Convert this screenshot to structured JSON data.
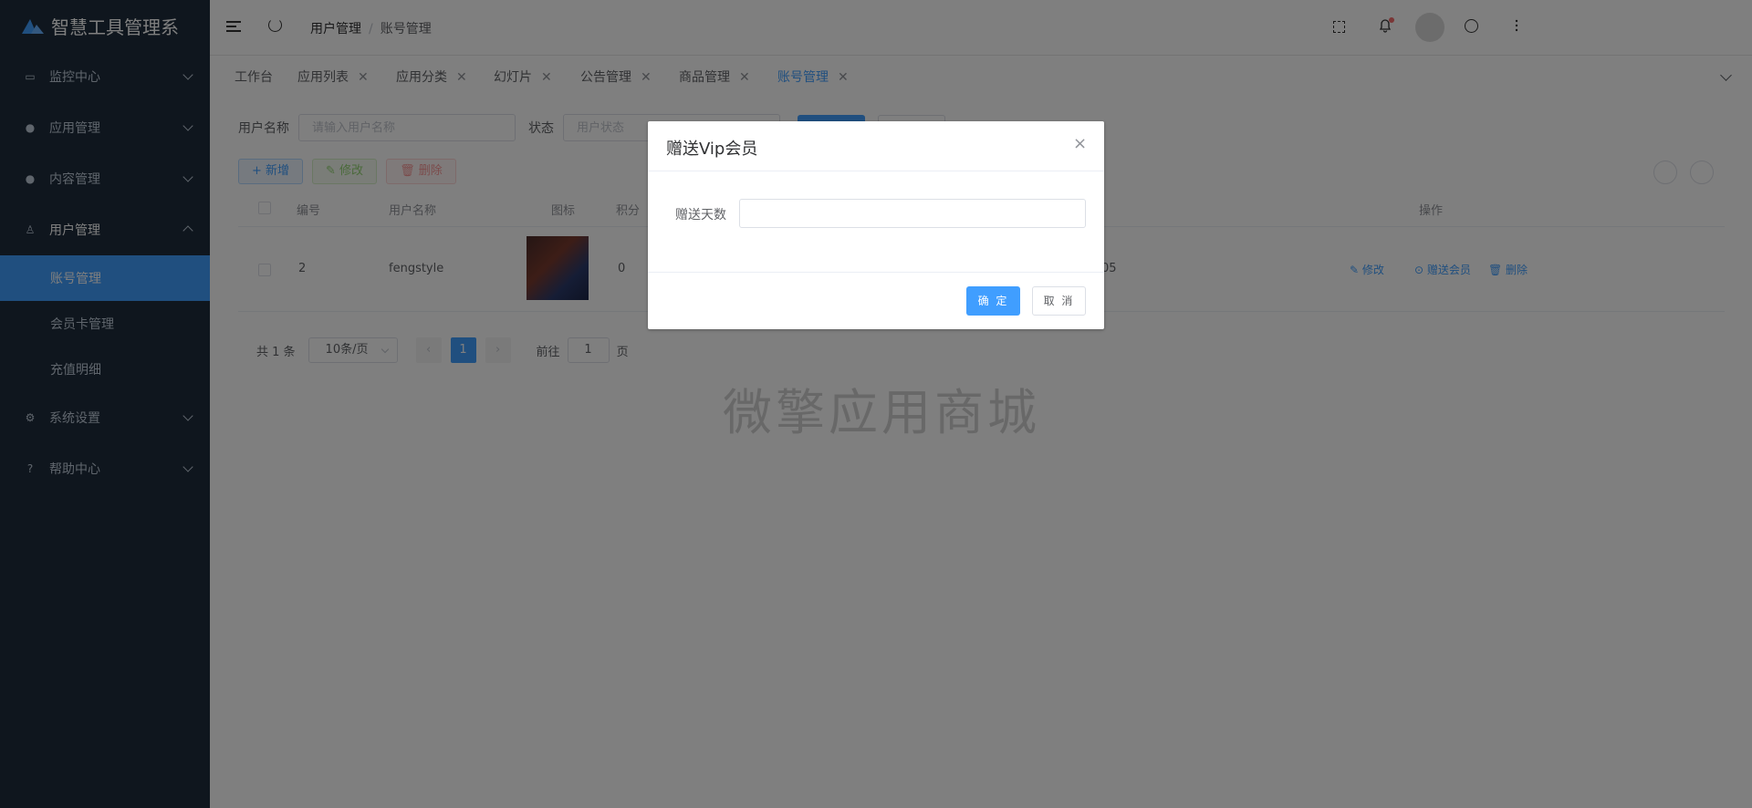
{
  "app": {
    "title": "智慧工具管理系"
  },
  "sidebar": {
    "items": [
      {
        "label": "监控中心",
        "icon": "monitor-icon"
      },
      {
        "label": "应用管理",
        "icon": "app-icon"
      },
      {
        "label": "内容管理",
        "icon": "content-icon"
      },
      {
        "label": "用户管理",
        "icon": "user-icon"
      },
      {
        "label": "系统设置",
        "icon": "gear-icon"
      },
      {
        "label": "帮助中心",
        "icon": "help-icon"
      }
    ],
    "submenu": [
      {
        "label": "账号管理"
      },
      {
        "label": "会员卡管理"
      },
      {
        "label": "充值明细"
      }
    ]
  },
  "header": {
    "breadcrumb": [
      "用户管理",
      "账号管理"
    ],
    "breadcrumb_sep": "/"
  },
  "tabs": [
    {
      "label": "工作台"
    },
    {
      "label": "应用列表"
    },
    {
      "label": "应用分类"
    },
    {
      "label": "幻灯片"
    },
    {
      "label": "公告管理"
    },
    {
      "label": "商品管理"
    },
    {
      "label": "账号管理"
    }
  ],
  "search": {
    "username_label": "用户名称",
    "username_placeholder": "请输入用户名称",
    "status_label": "状态",
    "status_placeholder": "用户状态"
  },
  "toolbar": {
    "add": "+ 新增",
    "edit": "✎ 修改",
    "delete": "🗑 删除"
  },
  "table": {
    "headers": [
      "编号",
      "用户名称",
      "图标",
      "积分",
      "操作"
    ],
    "row": {
      "id": "2",
      "username": "fengstyle",
      "points": "0",
      "partial": "05"
    },
    "ops": {
      "edit": "✎ 修改",
      "vip": "⊙ 赠送会员",
      "delete": "🗑 删除"
    }
  },
  "pagination": {
    "total": "共 1 条",
    "page_size": "10条/页",
    "current": "1",
    "goto_label": "前往",
    "goto_value": "1",
    "page_unit": "页"
  },
  "watermark": "微擎应用商城",
  "dialog": {
    "title": "赠送Vip会员",
    "field_label": "赠送天数",
    "ok": "确 定",
    "cancel": "取 消"
  },
  "colors": {
    "primary": "#409eff",
    "sidebar_bg": "#1f2d3d"
  }
}
